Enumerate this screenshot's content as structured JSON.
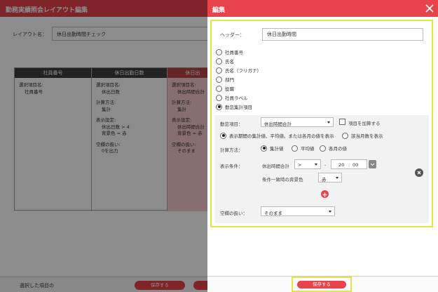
{
  "background": {
    "title": "勤務実績照会レイアウト編集",
    "layout_label": "レイアウト名：",
    "layout_value": "休日出勤時間チェック",
    "columns": [
      {
        "header": "社員番号",
        "lines": [
          "選択項目名:",
          "社員番号"
        ]
      },
      {
        "header": "休日出勤日数",
        "lines": [
          "選択項目名:",
          "休出日数",
          "",
          "計算方法:",
          "集計",
          "",
          "表示設定:",
          "休出日数 > 4",
          "背景色 = 赤",
          "",
          "空欄の扱い:",
          "0を出力"
        ]
      },
      {
        "header": "休日出",
        "lines": [
          "選択項目名:",
          "休出時間合計",
          "",
          "計算方法:",
          "集計",
          "",
          "表示設定:",
          "休出時間合計",
          "背景色 = 赤",
          "",
          "空欄の扱い:",
          "そのまま"
        ]
      }
    ],
    "footer_text": "選択した項目の",
    "footer_save": "保存する"
  },
  "modal": {
    "title": "編集",
    "header_label": "ヘッダー：",
    "header_value": "休日出勤時間",
    "item_types": [
      {
        "label": "社員番号",
        "selected": false
      },
      {
        "label": "氏名",
        "selected": false
      },
      {
        "label": "氏名（フリガナ）",
        "selected": false
      },
      {
        "label": "部門",
        "selected": false
      },
      {
        "label": "役職",
        "selected": false
      },
      {
        "label": "社員ラベル",
        "selected": false
      },
      {
        "label": "勤怠集計項目",
        "selected": true
      }
    ],
    "attendance_item_label": "勤怠項目：",
    "attendance_item_value": "休出時間合計",
    "add_item_label": "項目を加算する",
    "display_options": [
      {
        "label": "表示期間の集計値、平均値、または各月の値を表示",
        "selected": true
      },
      {
        "label": "該当月数を表示",
        "selected": false
      }
    ],
    "calc_label": "計算方法：",
    "calc_options": [
      {
        "label": "集計値",
        "selected": true
      },
      {
        "label": "平均値",
        "selected": false
      },
      {
        "label": "各月の値",
        "selected": false
      }
    ],
    "display_cond_label": "表示条件：",
    "cond_item": "休出時間合計",
    "cond_operator": ">",
    "cond_dash": "-",
    "cond_hours": "20",
    "cond_sep": ":",
    "cond_minutes": "00",
    "bg_color_label": "条件一致時の背景色",
    "bg_color_value": "赤",
    "blank_label": "空欄の扱い：",
    "blank_value": "そのまま",
    "save_label": "保存する"
  },
  "colors": {
    "accent": "#e8434a",
    "highlight": "#e6e24a"
  }
}
